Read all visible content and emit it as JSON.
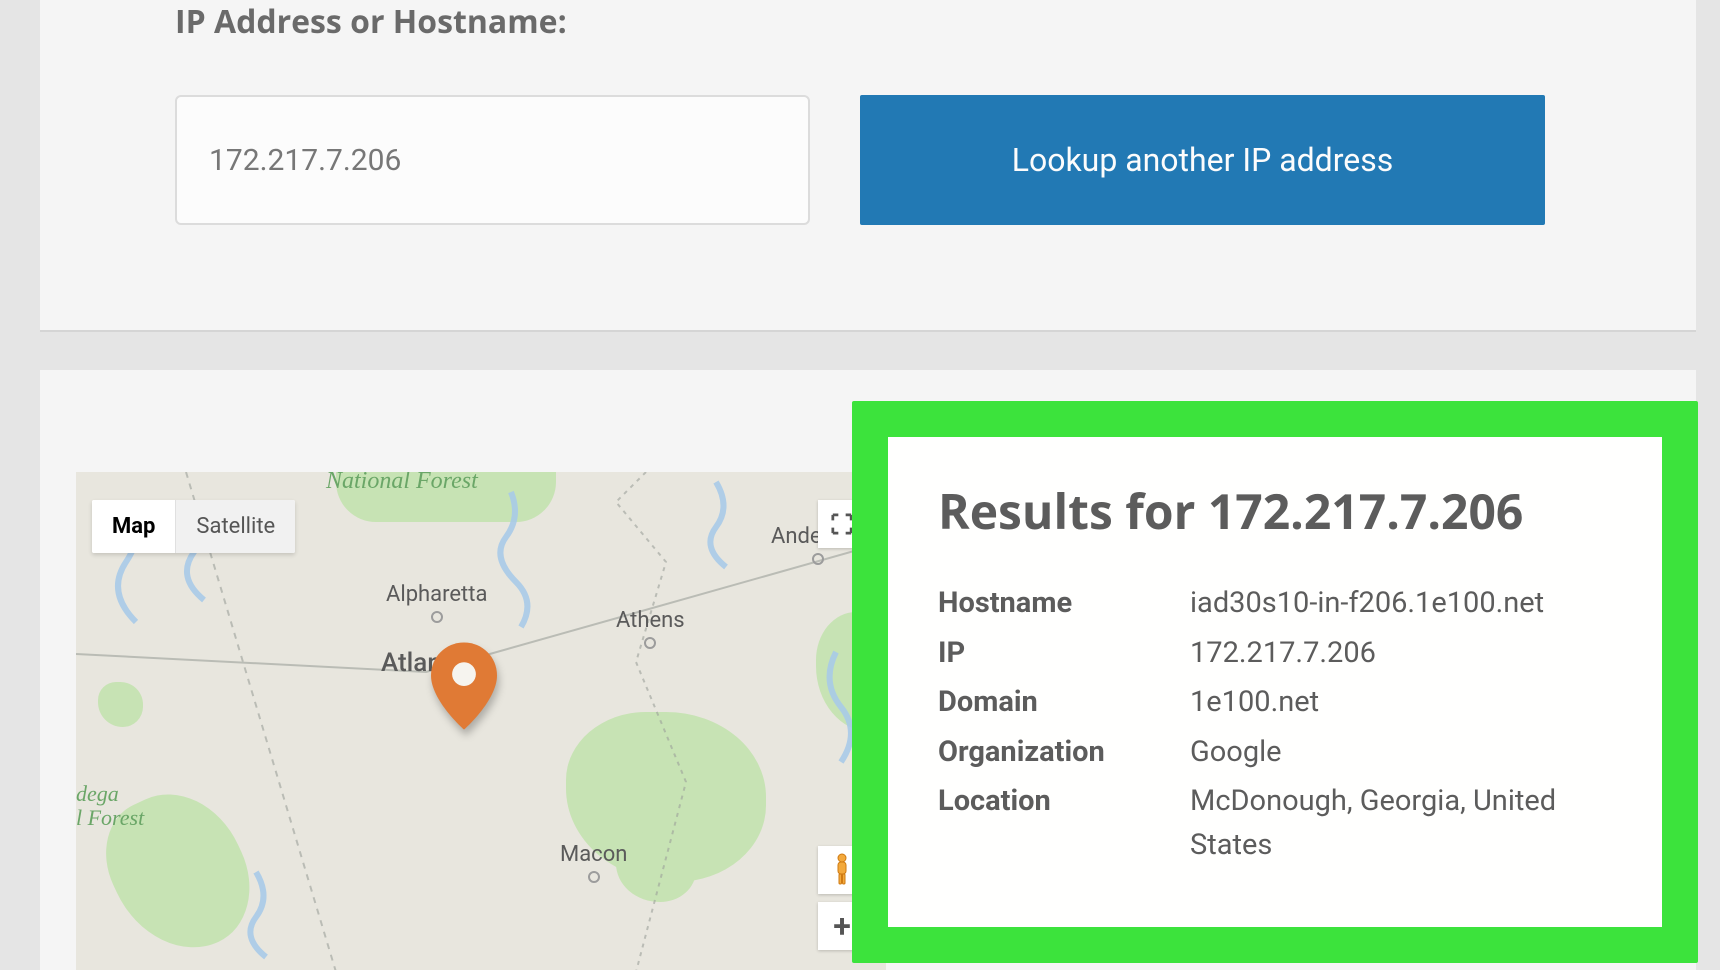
{
  "form": {
    "label": "IP Address or Hostname:",
    "input_value": "172.217.7.206",
    "button_label": "Lookup another IP address"
  },
  "map": {
    "controls": {
      "map_label": "Map",
      "satellite_label": "Satellite"
    },
    "labels": {
      "national_forest": "National Forest",
      "talladega_1": "dega",
      "talladega_2": "l Forest",
      "alpharetta": "Alpharetta",
      "athens": "Athens",
      "atlanta": "Atlanta",
      "macon": "Macon",
      "anderson": "Anderson"
    }
  },
  "results": {
    "title": "Results for 172.217.7.206",
    "rows": [
      {
        "key": "Hostname",
        "value": "iad30s10-in-f206.1e100.net"
      },
      {
        "key": "IP",
        "value": "172.217.7.206"
      },
      {
        "key": "Domain",
        "value": "1e100.net"
      },
      {
        "key": "Organization",
        "value": "Google"
      },
      {
        "key": "Location",
        "value": "McDonough, Georgia, United States"
      }
    ]
  }
}
